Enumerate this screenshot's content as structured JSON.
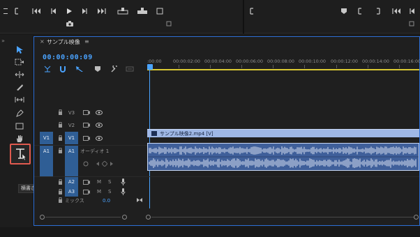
{
  "timeline": {
    "tab_close": "×",
    "tab_title": "サンプル映像",
    "tab_menu": "≡",
    "timecode": "00:00:00:09",
    "ruler_labels": [
      ":00:00",
      "00:00:02:00",
      "00:00:04:00",
      "00:00:06:00",
      "00:00:08:00",
      "00:00:10:00",
      "00:00:12:00",
      "00:00:14:00",
      "00:00:16:00"
    ],
    "tracks": {
      "v3": {
        "target": "V3"
      },
      "v2": {
        "target": "V2"
      },
      "v1": {
        "source": "V1",
        "target": "V1"
      },
      "a1": {
        "source": "A1",
        "target": "A1",
        "name": "オーディオ 1",
        "mute": "M",
        "solo": "S"
      },
      "a2": {
        "target": "A2",
        "mute": "M",
        "solo": "S"
      },
      "a3": {
        "target": "A3",
        "mute": "M",
        "solo": "S"
      }
    },
    "video_clip_label": "サンプル映像2.mp4 [V]",
    "mix_label": "ミックス",
    "mix_value": "0.0"
  },
  "tooltip": "横書き文字ツール (T)",
  "colors": {
    "accent": "#4aa3ff",
    "work_area": "#d9c934",
    "highlight_box": "#e05a4f",
    "patch": "#2f5e95",
    "video_clip": "#9fb8e6",
    "audio_clip": "#3f5f9a"
  }
}
